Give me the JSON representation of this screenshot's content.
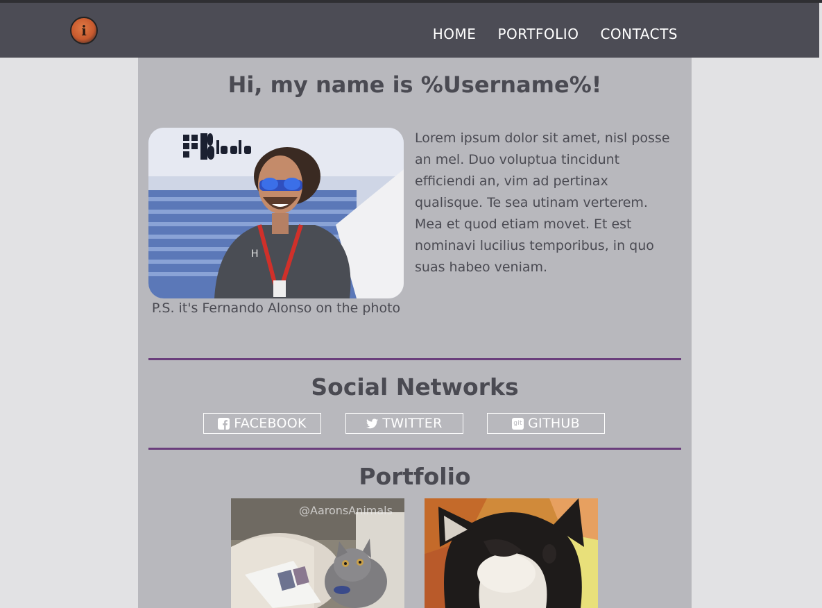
{
  "header": {
    "logo_letter": "i",
    "nav": [
      {
        "label": "HOME"
      },
      {
        "label": "PORTFOLIO"
      },
      {
        "label": "CONTACTS"
      }
    ]
  },
  "hero": {
    "title": "Hi, my name is %Username%!",
    "photo_icon": "portrait-photo",
    "caption": "P.S. it's Fernando Alonso on the photo",
    "bio": "Lorem ipsum dolor sit amet, nisl posse an mel. Duo voluptua tincidunt efficiendi an, vim ad pertinax qualisque. Te sea utinam verterem. Mea et quod etiam movet. Et est nominavi lucilius temporibus, in quo suas habeo veniam."
  },
  "social": {
    "title": "Social Networks",
    "buttons": [
      {
        "label": "FACEBOOK",
        "icon": "facebook-icon"
      },
      {
        "label": "TWITTER",
        "icon": "twitter-icon"
      },
      {
        "label": "GITHUB",
        "icon": "git-icon",
        "icon_text": "git"
      }
    ]
  },
  "portfolio": {
    "title": "Portfolio",
    "items": [
      {
        "icon": "cat-thumbnail",
        "watermark": "@AaronsAnimals"
      },
      {
        "icon": "dog-thumbnail"
      }
    ]
  },
  "colors": {
    "navbar": "#4c4c55",
    "content": "#b8b8bd",
    "page_bg": "#e2e2e4",
    "accent_divider": "#6a3e7c",
    "text": "#4a4a52"
  }
}
